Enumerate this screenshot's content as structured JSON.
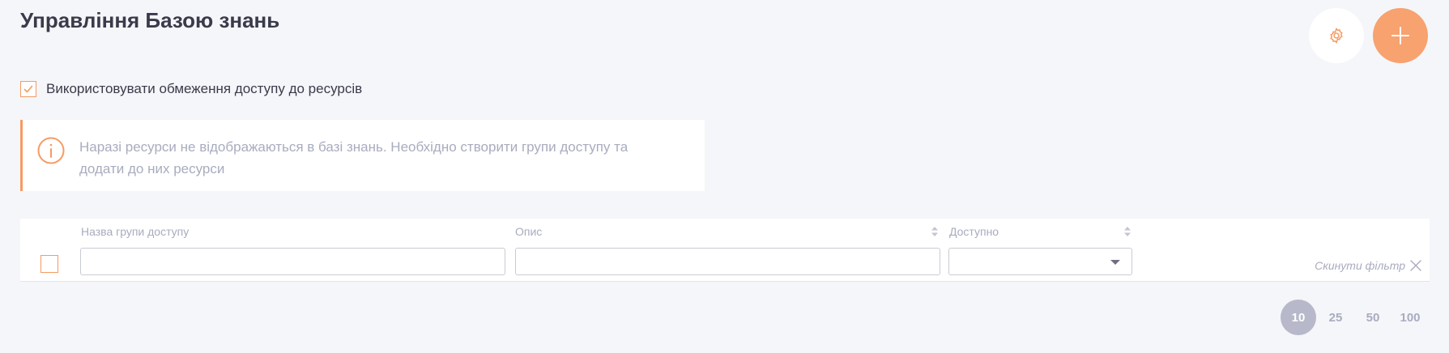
{
  "header": {
    "title": "Управління Базою знань",
    "settings_icon": "gear-icon",
    "add_icon": "plus-icon"
  },
  "access_restriction": {
    "label": "Використовувати обмеження доступу до ресурсів",
    "checked": true
  },
  "info": {
    "icon": "info-circle-icon",
    "text_line1": "Наразі ресурси не відображаються в базі знань. Необхідно створити групи доступу та",
    "text_line2": "додати до них ресурси"
  },
  "table": {
    "columns": [
      {
        "label": "Назва групи доступу",
        "sortable": false
      },
      {
        "label": "Опис",
        "sortable": true
      },
      {
        "label": "Доступно",
        "sortable": true
      }
    ],
    "filters": {
      "name_value": "",
      "description_value": "",
      "available_value": ""
    },
    "reset_filter_label": "Скинути фільтр"
  },
  "pagination": {
    "sizes": [
      "10",
      "25",
      "50",
      "100"
    ],
    "selected": "10"
  },
  "colors": {
    "accent": "#f59b62",
    "add_button": "#f7a26f",
    "background": "#f5f6fa",
    "muted_text": "#a8acbe",
    "active_page": "#b7b8c9"
  }
}
